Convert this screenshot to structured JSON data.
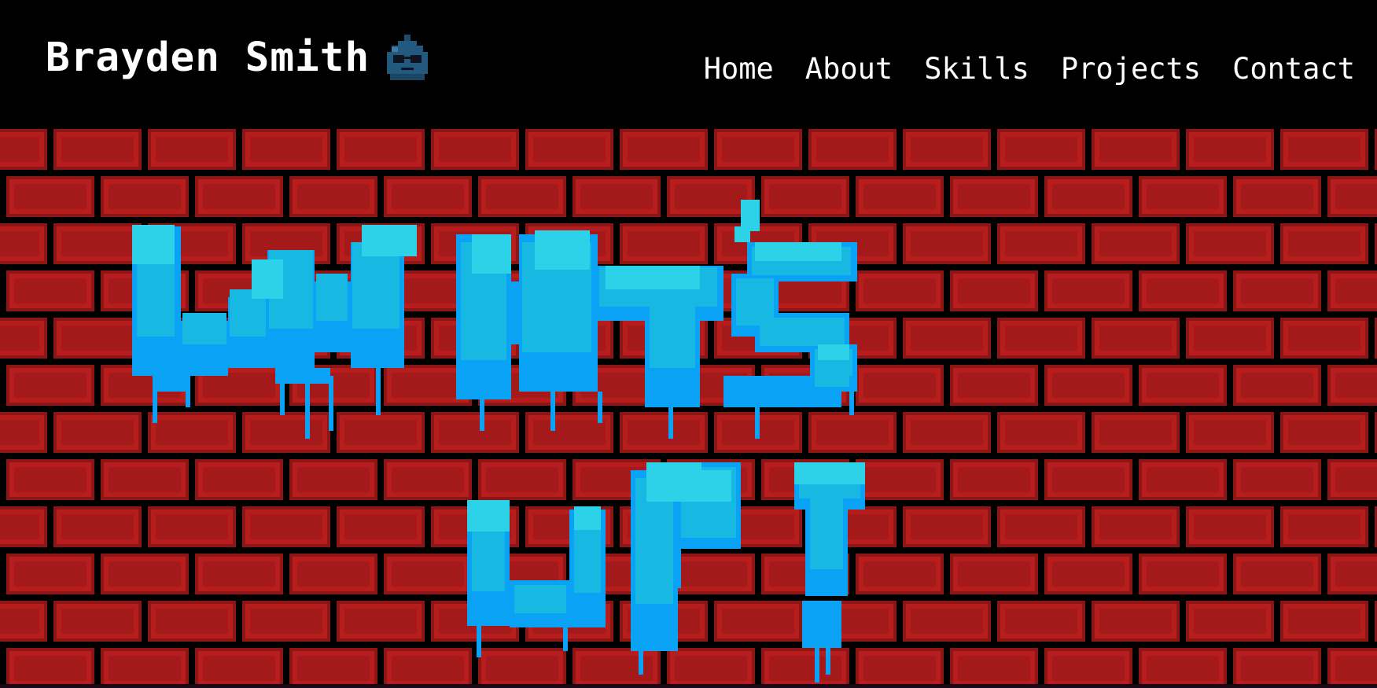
{
  "header": {
    "brand_name": "Brayden Smith",
    "avatar_icon": "blue-blob-with-sunglasses-icon"
  },
  "nav": {
    "items": [
      {
        "label": "Home"
      },
      {
        "label": "About"
      },
      {
        "label": "Skills"
      },
      {
        "label": "Projects"
      },
      {
        "label": "Contact"
      }
    ]
  },
  "hero": {
    "graffiti_text": "WHAT'S UP!",
    "background": "red-brick-wall",
    "colors": {
      "brick": "#b71d1d",
      "brick_inner": "#a41a1a",
      "mortar": "#000000",
      "graffiti_light": "#2cd3e8",
      "graffiti_mid": "#17b9e3",
      "graffiti_dark": "#0aa2f5"
    }
  }
}
